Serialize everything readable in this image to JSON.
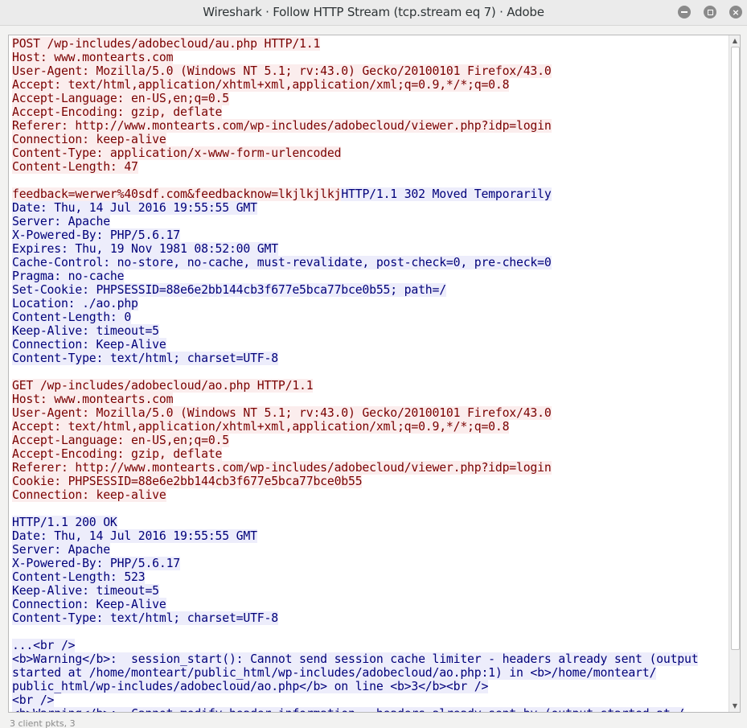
{
  "window": {
    "title": "Wireshark · Follow HTTP Stream (tcp.stream eq 7) · Adobe",
    "controls": {
      "minimize": "",
      "maximize": "",
      "close": "×"
    }
  },
  "colors": {
    "client_text": "#7a0000",
    "client_bg": "#fbeded",
    "server_text": "#00007a",
    "server_bg": "#ededfb"
  },
  "stream": {
    "lines": [
      [
        {
          "t": "c",
          "v": "POST /wp-includes/adobecloud/au.php HTTP/1.1"
        }
      ],
      [
        {
          "t": "c",
          "v": "Host: www.montearts.com"
        }
      ],
      [
        {
          "t": "c",
          "v": "User-Agent: Mozilla/5.0 (Windows NT 5.1; rv:43.0) Gecko/20100101 Firefox/43.0"
        }
      ],
      [
        {
          "t": "c",
          "v": "Accept: text/html,application/xhtml+xml,application/xml;q=0.9,*/*;q=0.8"
        }
      ],
      [
        {
          "t": "c",
          "v": "Accept-Language: en-US,en;q=0.5"
        }
      ],
      [
        {
          "t": "c",
          "v": "Accept-Encoding: gzip, deflate"
        }
      ],
      [
        {
          "t": "c",
          "v": "Referer: http://www.montearts.com/wp-includes/adobecloud/viewer.php?idp=login"
        }
      ],
      [
        {
          "t": "c",
          "v": "Connection: keep-alive"
        }
      ],
      [
        {
          "t": "c",
          "v": "Content-Type: application/x-www-form-urlencoded"
        }
      ],
      [
        {
          "t": "c",
          "v": "Content-Length: 47"
        }
      ],
      [],
      [
        {
          "t": "c",
          "v": "feedback=werwer%40sdf.com&feedbacknow=lkjlkjlkj"
        },
        {
          "t": "s",
          "v": "HTTP/1.1 302 Moved Temporarily"
        }
      ],
      [
        {
          "t": "s",
          "v": "Date: Thu, 14 Jul 2016 19:55:55 GMT"
        }
      ],
      [
        {
          "t": "s",
          "v": "Server: Apache"
        }
      ],
      [
        {
          "t": "s",
          "v": "X-Powered-By: PHP/5.6.17"
        }
      ],
      [
        {
          "t": "s",
          "v": "Expires: Thu, 19 Nov 1981 08:52:00 GMT"
        }
      ],
      [
        {
          "t": "s",
          "v": "Cache-Control: no-store, no-cache, must-revalidate, post-check=0, pre-check=0"
        }
      ],
      [
        {
          "t": "s",
          "v": "Pragma: no-cache"
        }
      ],
      [
        {
          "t": "s",
          "v": "Set-Cookie: PHPSESSID=88e6e2bb144cb3f677e5bca77bce0b55; path=/"
        }
      ],
      [
        {
          "t": "s",
          "v": "Location: ./ao.php"
        }
      ],
      [
        {
          "t": "s",
          "v": "Content-Length: 0"
        }
      ],
      [
        {
          "t": "s",
          "v": "Keep-Alive: timeout=5"
        }
      ],
      [
        {
          "t": "s",
          "v": "Connection: Keep-Alive"
        }
      ],
      [
        {
          "t": "s",
          "v": "Content-Type: text/html; charset=UTF-8"
        }
      ],
      [],
      [
        {
          "t": "c",
          "v": "GET /wp-includes/adobecloud/ao.php HTTP/1.1"
        }
      ],
      [
        {
          "t": "c",
          "v": "Host: www.montearts.com"
        }
      ],
      [
        {
          "t": "c",
          "v": "User-Agent: Mozilla/5.0 (Windows NT 5.1; rv:43.0) Gecko/20100101 Firefox/43.0"
        }
      ],
      [
        {
          "t": "c",
          "v": "Accept: text/html,application/xhtml+xml,application/xml;q=0.9,*/*;q=0.8"
        }
      ],
      [
        {
          "t": "c",
          "v": "Accept-Language: en-US,en;q=0.5"
        }
      ],
      [
        {
          "t": "c",
          "v": "Accept-Encoding: gzip, deflate"
        }
      ],
      [
        {
          "t": "c",
          "v": "Referer: http://www.montearts.com/wp-includes/adobecloud/viewer.php?idp=login"
        }
      ],
      [
        {
          "t": "c",
          "v": "Cookie: PHPSESSID=88e6e2bb144cb3f677e5bca77bce0b55"
        }
      ],
      [
        {
          "t": "c",
          "v": "Connection: keep-alive"
        }
      ],
      [],
      [
        {
          "t": "s",
          "v": "HTTP/1.1 200 OK"
        }
      ],
      [
        {
          "t": "s",
          "v": "Date: Thu, 14 Jul 2016 19:55:55 GMT"
        }
      ],
      [
        {
          "t": "s",
          "v": "Server: Apache"
        }
      ],
      [
        {
          "t": "s",
          "v": "X-Powered-By: PHP/5.6.17"
        }
      ],
      [
        {
          "t": "s",
          "v": "Content-Length: 523"
        }
      ],
      [
        {
          "t": "s",
          "v": "Keep-Alive: timeout=5"
        }
      ],
      [
        {
          "t": "s",
          "v": "Connection: Keep-Alive"
        }
      ],
      [
        {
          "t": "s",
          "v": "Content-Type: text/html; charset=UTF-8"
        }
      ],
      [],
      [
        {
          "t": "s",
          "v": "...<br />"
        }
      ],
      [
        {
          "t": "s",
          "v": "<b>Warning</b>:  session_start(): Cannot send session cache limiter - headers already sent (output"
        }
      ],
      [
        {
          "t": "s",
          "v": "started at /home/monteart/public_html/wp-includes/adobecloud/ao.php:1) in <b>/home/monteart/"
        }
      ],
      [
        {
          "t": "s",
          "v": "public_html/wp-includes/adobecloud/ao.php</b> on line <b>3</b><br />"
        }
      ],
      [
        {
          "t": "s",
          "v": "<br />"
        }
      ],
      [
        {
          "t": "s",
          "v": "<b>Warning</b>:  Cannot modify header information - headers already sent by (output started at /"
        }
      ]
    ]
  },
  "scrollbar": {
    "up_arrow": "▲",
    "down_arrow": "▼",
    "position_fraction": 0.0,
    "visible_fraction": 0.92
  },
  "footer_peek": "3 client pkts, 3"
}
